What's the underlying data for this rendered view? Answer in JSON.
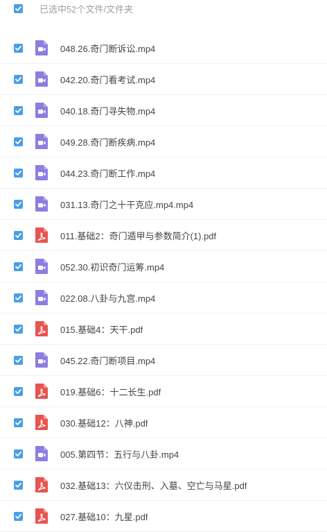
{
  "header": {
    "selection_label": "已选中52个文件/文件夹"
  },
  "icons": {
    "checkbox": "checkmark-icon",
    "video": "video-file-icon",
    "pdf": "pdf-file-icon"
  },
  "colors": {
    "checkbox": "#4a9fe8",
    "video_icon": "#8c7ee0",
    "pdf_icon": "#e8544f",
    "text": "#454545"
  },
  "files": [
    {
      "name": "048.26.奇门断诉讼.mp4",
      "type": "video"
    },
    {
      "name": "042.20.奇门看考试.mp4",
      "type": "video"
    },
    {
      "name": "040.18.奇门寻失物.mp4",
      "type": "video"
    },
    {
      "name": "049.28.奇门断疾病.mp4",
      "type": "video"
    },
    {
      "name": "044.23.奇门断工作.mp4",
      "type": "video"
    },
    {
      "name": "031.13.奇门之十干克应.mp4.mp4",
      "type": "video"
    },
    {
      "name": "011.基础2：奇门遁甲与参数简介(1).pdf",
      "type": "pdf"
    },
    {
      "name": "052.30.初识奇门运筹.mp4",
      "type": "video"
    },
    {
      "name": "022.08.八卦与九宫.mp4",
      "type": "video"
    },
    {
      "name": "015.基础4：天干.pdf",
      "type": "pdf"
    },
    {
      "name": "045.22.奇门断项目.mp4",
      "type": "video"
    },
    {
      "name": "019.基础6：十二长生.pdf",
      "type": "pdf"
    },
    {
      "name": "030.基础12：八神.pdf",
      "type": "pdf"
    },
    {
      "name": "005.第四节：五行与八卦.mp4",
      "type": "video"
    },
    {
      "name": "032.基础13：六仪击刑、入墓、空亡与马星.pdf",
      "type": "pdf"
    },
    {
      "name": "027.基础10：九星.pdf",
      "type": "pdf"
    }
  ]
}
